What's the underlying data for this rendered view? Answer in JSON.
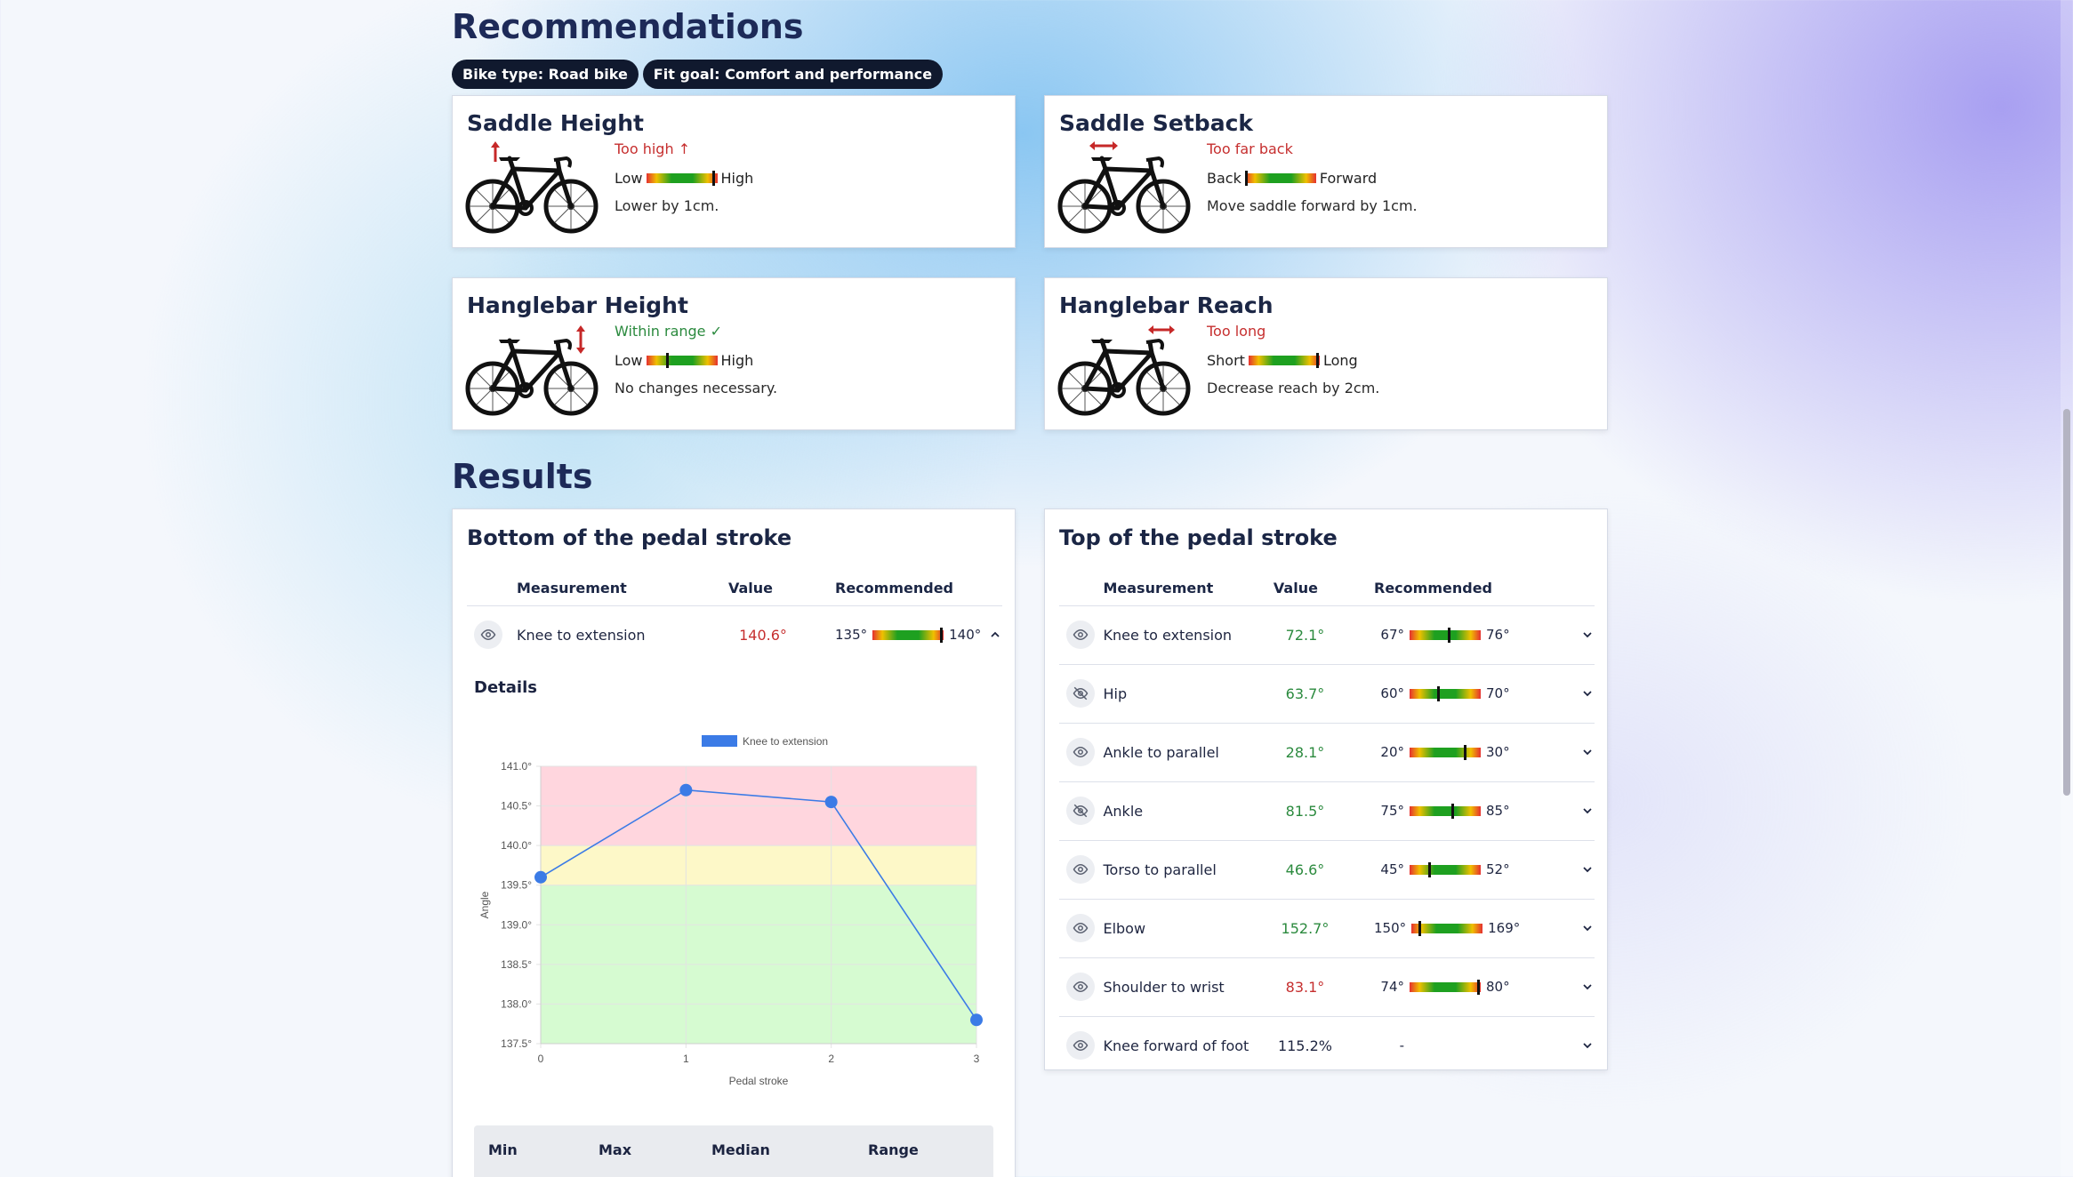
{
  "recommendations": {
    "title": "Recommendations",
    "pills": [
      "Bike type: Road bike",
      "Fit goal: Comfort and performance"
    ],
    "cards": [
      {
        "title": "Saddle Height",
        "status": "Too high ↑",
        "status_color": "#c62f2f",
        "low": "Low",
        "high": "High",
        "position": 0.95,
        "note": "Lower by 1cm.",
        "arrow": "saddle-vertical"
      },
      {
        "title": "Saddle Setback",
        "status": "Too far back",
        "status_color": "#c62f2f",
        "low": "Back",
        "high": "Forward",
        "position": 0.02,
        "note": "Move saddle forward by 1cm.",
        "arrow": "saddle-horizontal"
      },
      {
        "title": "Hanglebar Height",
        "status": "Within range ✓",
        "status_color": "#2b8a3e",
        "low": "Low",
        "high": "High",
        "position": 0.3,
        "note": "No changes necessary.",
        "arrow": "bar-vertical"
      },
      {
        "title": "Hanglebar Reach",
        "status": "Too long",
        "status_color": "#c62f2f",
        "low": "Short",
        "high": "Long",
        "position": 0.97,
        "note": "Decrease reach by 2cm.",
        "arrow": "bar-horizontal"
      }
    ]
  },
  "results": {
    "title": "Results",
    "bottom": {
      "title": "Bottom of the pedal stroke",
      "headers": [
        "Measurement",
        "Value",
        "Recommended"
      ],
      "rows": [
        {
          "name": "Knee to extension",
          "value": "140.6°",
          "value_color": "#c62f2f",
          "min": "135°",
          "max": "140°",
          "position": 0.97,
          "icon": "eye-icon",
          "expanded": true
        }
      ],
      "details_title": "Details",
      "stats_headers": [
        "Min",
        "Max",
        "Median",
        "Range"
      ]
    },
    "top": {
      "title": "Top of the pedal stroke",
      "headers": [
        "Measurement",
        "Value",
        "Recommended"
      ],
      "rows": [
        {
          "name": "Knee to extension",
          "value": "72.1°",
          "value_color": "#2b8a3e",
          "min": "67°",
          "max": "76°",
          "position": 0.55,
          "icon": "eye-icon"
        },
        {
          "name": "Hip",
          "value": "63.7°",
          "value_color": "#2b8a3e",
          "min": "60°",
          "max": "70°",
          "position": 0.4,
          "icon": "eye-off-icon"
        },
        {
          "name": "Ankle to parallel",
          "value": "28.1°",
          "value_color": "#2b8a3e",
          "min": "20°",
          "max": "30°",
          "position": 0.78,
          "icon": "eye-icon"
        },
        {
          "name": "Ankle",
          "value": "81.5°",
          "value_color": "#2b8a3e",
          "min": "75°",
          "max": "85°",
          "position": 0.6,
          "icon": "eye-off-icon"
        },
        {
          "name": "Torso to parallel",
          "value": "46.6°",
          "value_color": "#2b8a3e",
          "min": "45°",
          "max": "52°",
          "position": 0.28,
          "icon": "eye-icon"
        },
        {
          "name": "Elbow",
          "value": "152.7°",
          "value_color": "#2b8a3e",
          "min": "150°",
          "max": "169°",
          "position": 0.12,
          "icon": "eye-icon"
        },
        {
          "name": "Shoulder to wrist",
          "value": "83.1°",
          "value_color": "#c62f2f",
          "min": "74°",
          "max": "80°",
          "position": 0.97,
          "icon": "eye-icon"
        },
        {
          "name": "Knee forward of foot",
          "value": "115.2%",
          "value_color": "#1e2540",
          "min": "-",
          "max": "",
          "position": null,
          "icon": "eye-icon"
        }
      ]
    }
  },
  "chart_data": {
    "type": "line",
    "legend": "Knee to extension",
    "series_color": "#3b7be6",
    "x": [
      0,
      1,
      2,
      3
    ],
    "values": [
      139.6,
      140.7,
      140.55,
      137.8
    ],
    "ylabel": "Angle",
    "xlabel": "Pedal stroke",
    "yticks": [
      "141.0°",
      "140.5°",
      "140.0°",
      "139.5°",
      "139.0°",
      "138.5°",
      "138.0°",
      "137.5°"
    ],
    "xticks": [
      "0",
      "1",
      "2",
      "3"
    ],
    "ylim": [
      137.5,
      141.0
    ],
    "bands": [
      {
        "from": 140.0,
        "to": 141.0,
        "color": "#ffd6de"
      },
      {
        "from": 139.5,
        "to": 140.0,
        "color": "#fdf8c8"
      },
      {
        "from": 137.5,
        "to": 139.5,
        "color": "#d6fbd1"
      }
    ],
    "grid": true,
    "legend_position": "top"
  }
}
